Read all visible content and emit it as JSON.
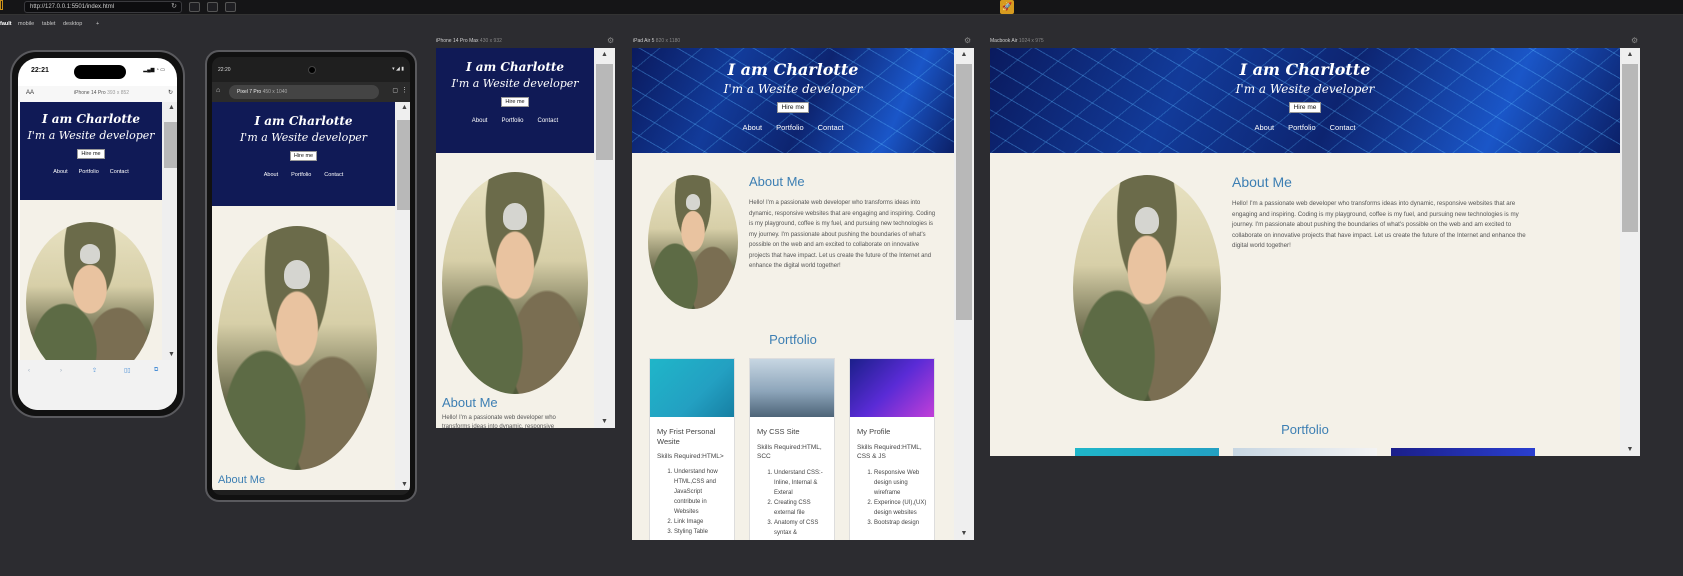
{
  "toolbar": {
    "url": "http://127.0.0.1:5501/index.html",
    "tabs": [
      "fault",
      "mobile",
      "tablet",
      "desktop",
      "+"
    ]
  },
  "devices": {
    "iphone14pro": {
      "label": "iPhone 14 Pro",
      "size": "393 x 852",
      "time": "22:21",
      "aa": "AA"
    },
    "pixel7pro": {
      "label": "Pixel 7 Pro",
      "size": "450 x 1040",
      "time": "22:20"
    },
    "iphone14promax": {
      "label": "iPhone 14 Pro Max",
      "size": "430 x 932"
    },
    "ipadair5": {
      "label": "iPad Air 5",
      "size": "820 x 1180"
    },
    "macbookair": {
      "label": "Macbook Air",
      "size": "1024 x 975"
    }
  },
  "site": {
    "title": "I am Charlotte",
    "subtitle": "I'm a Wesite developer",
    "hire_label": "Hire me",
    "nav": [
      "About",
      "Portfolio",
      "Contact"
    ],
    "about_heading": "About Me",
    "about_text": "Hello! I'm a passionate web developer who transforms ideas into dynamic, responsive websites that are engaging and inspiring. Coding is my playground, coffee is my fuel, and pursuing new technologies is my journey. I'm passionate about pushing the boundaries of what's possible on the web and am excited to collaborate on innovative projects that have impact. Let us create the future of the Internet and enhance the digital world together!",
    "about_text_short": "Hello! I'm a passionate web developer who transforms ideas into dynamic, responsive",
    "portfolio_heading": "Portfolio",
    "cards": [
      {
        "title": "My Frist Personal Wesite",
        "skills": "Skills Required:HTML>",
        "items": [
          "Understand how HTML,CSS and JavaScript contribute in Websites",
          "Link Image",
          "Styling Table"
        ]
      },
      {
        "title": "My CSS Site",
        "skills": "Skills Required:HTML, SCC",
        "items": [
          "Understand CSS:- Inline, Internal & Exteral",
          "Creating CSS external file",
          "Anatomy of CSS syntax &"
        ]
      },
      {
        "title": "My Profile",
        "skills": "Skills Required:HTML, CSS & JS",
        "items": [
          "Responsive Web design using wireframe",
          "Experince (UI),(UX) design websites",
          "Bootstrap design"
        ]
      }
    ]
  },
  "colors": {
    "header": "#101a56",
    "accent": "#3d7fb3",
    "page_bg": "#f4f1e8"
  }
}
